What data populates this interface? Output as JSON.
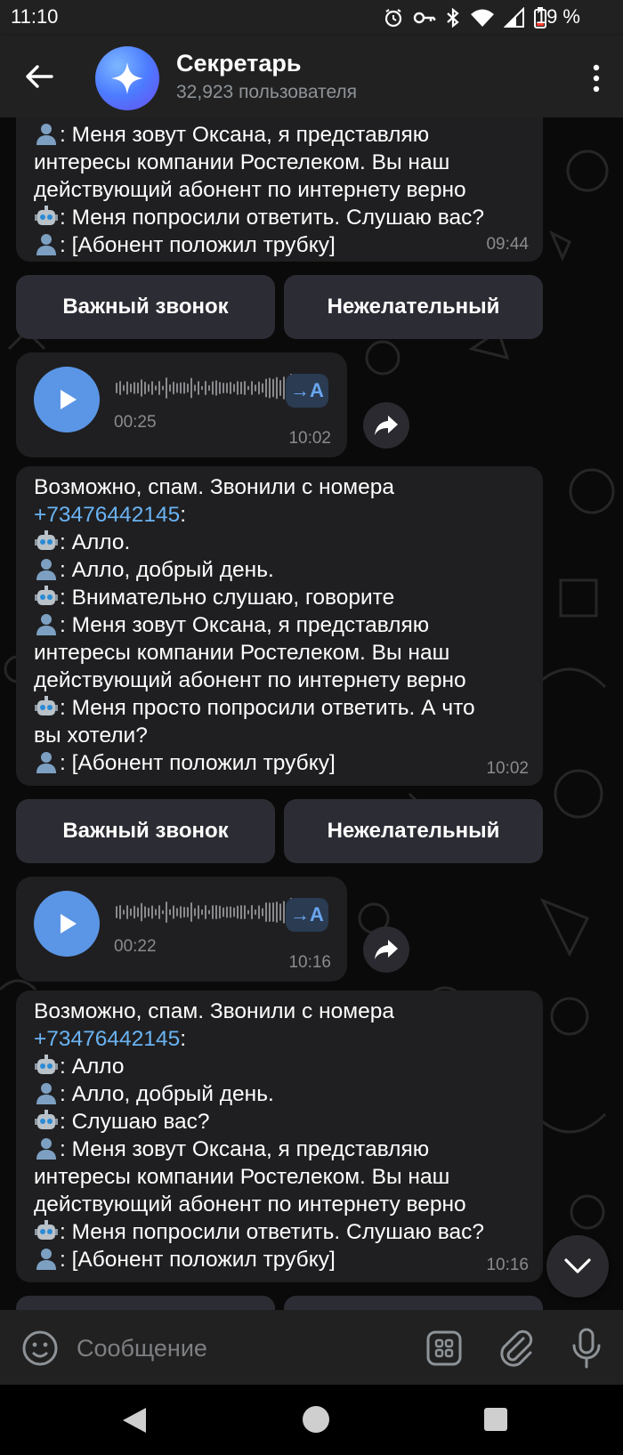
{
  "status_bar": {
    "time": "11:10",
    "battery": "19 %"
  },
  "header": {
    "title": "Секретарь",
    "subtitle": "32,923 пользователя"
  },
  "messages": [
    {
      "lines": [
        {
          "icon": "user",
          "text": ": Меня зовут Оксана, я представляю"
        },
        {
          "text": "интересы компании Ростелеком. Вы наш"
        },
        {
          "text": "действующий абонент по интернету верно"
        },
        {
          "icon": "robot",
          "text": ": Меня попросили ответить. Слушаю вас?"
        },
        {
          "icon": "user",
          "text": ": [Абонент положил трубку]"
        }
      ],
      "time": "09:44"
    },
    {
      "intro": "Возможно, спам. Звонили с номера",
      "phone": "+73476442145",
      "phone_suffix": ":",
      "lines": [
        {
          "icon": "robot",
          "text": ": Алло."
        },
        {
          "icon": "user",
          "text": ": Алло, добрый день."
        },
        {
          "icon": "robot",
          "text": ": Внимательно слушаю, говорите"
        },
        {
          "icon": "user",
          "text": ": Меня зовут Оксана, я представляю"
        },
        {
          "text": "интересы компании Ростелеком. Вы наш"
        },
        {
          "text": "действующий абонент по интернету верно"
        },
        {
          "icon": "robot",
          "text": ": Меня просто попросили ответить. А что"
        },
        {
          "text": "вы хотели?"
        },
        {
          "icon": "user",
          "text": ": [Абонент положил трубку]"
        }
      ],
      "time": "10:02"
    },
    {
      "intro": "Возможно, спам. Звонили с номера",
      "phone": "+73476442145",
      "phone_suffix": ":",
      "lines": [
        {
          "icon": "robot",
          "text": ": Алло"
        },
        {
          "icon": "user",
          "text": ": Алло, добрый день."
        },
        {
          "icon": "robot",
          "text": ": Слушаю вас?"
        },
        {
          "icon": "user",
          "text": ": Меня зовут Оксана, я представляю"
        },
        {
          "text": "интересы компании Ростелеком. Вы наш"
        },
        {
          "text": "действующий абонент по интернету верно"
        },
        {
          "icon": "robot",
          "text": ": Меня попросили ответить. Слушаю вас?"
        },
        {
          "icon": "user",
          "text": ": [Абонент положил трубку]"
        }
      ],
      "time": "10:16"
    }
  ],
  "buttons": {
    "important": "Важный звонок",
    "unwanted": "Нежелательный"
  },
  "voice_messages": [
    {
      "duration": "00:25",
      "time": "10:02",
      "transcribe_label": "→A"
    },
    {
      "duration": "00:22",
      "time": "10:16",
      "transcribe_label": "→A"
    }
  ],
  "input": {
    "placeholder": "Сообщение"
  },
  "icons": {
    "back": "back-arrow-icon",
    "menu": "more-vertical-icon",
    "play": "play-icon",
    "share": "share-icon",
    "scroll": "chevron-down-icon",
    "emoji": "emoji-icon",
    "bot_commands": "bot-commands-icon",
    "attach": "paperclip-icon",
    "mic": "microphone-icon"
  },
  "colors": {
    "accent": "#5b96e6",
    "link": "#6ab3f3",
    "bubble": "#1f1f21",
    "inline_button": "#2c2c34"
  }
}
